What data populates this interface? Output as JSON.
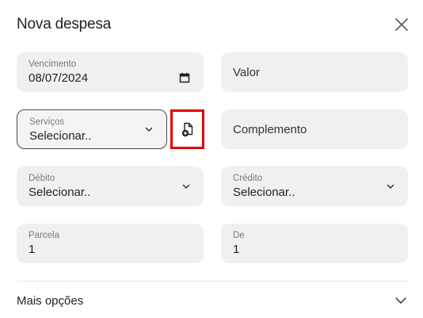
{
  "dialog": {
    "title": "Nova despesa"
  },
  "fields": {
    "vencimento": {
      "label": "Vencimento",
      "value": "08/07/2024"
    },
    "valor": {
      "placeholder": "Valor"
    },
    "servicos": {
      "label": "Serviços",
      "value": "Selecionar.."
    },
    "complemento": {
      "placeholder": "Complemento"
    },
    "debito": {
      "label": "Débito",
      "value": "Selecionar.."
    },
    "credito": {
      "label": "Crédito",
      "value": "Selecionar.."
    },
    "parcela": {
      "label": "Parcela",
      "value": "1"
    },
    "de": {
      "label": "De",
      "value": "1"
    }
  },
  "more_options": {
    "label": "Mais opções"
  },
  "icons": {
    "close": "close-icon",
    "calendar": "calendar-icon",
    "chevron": "chevron-down-icon",
    "add_document": "document-add-icon"
  },
  "colors": {
    "highlight_border": "#e00000",
    "field_bg": "#f0f0f0"
  }
}
